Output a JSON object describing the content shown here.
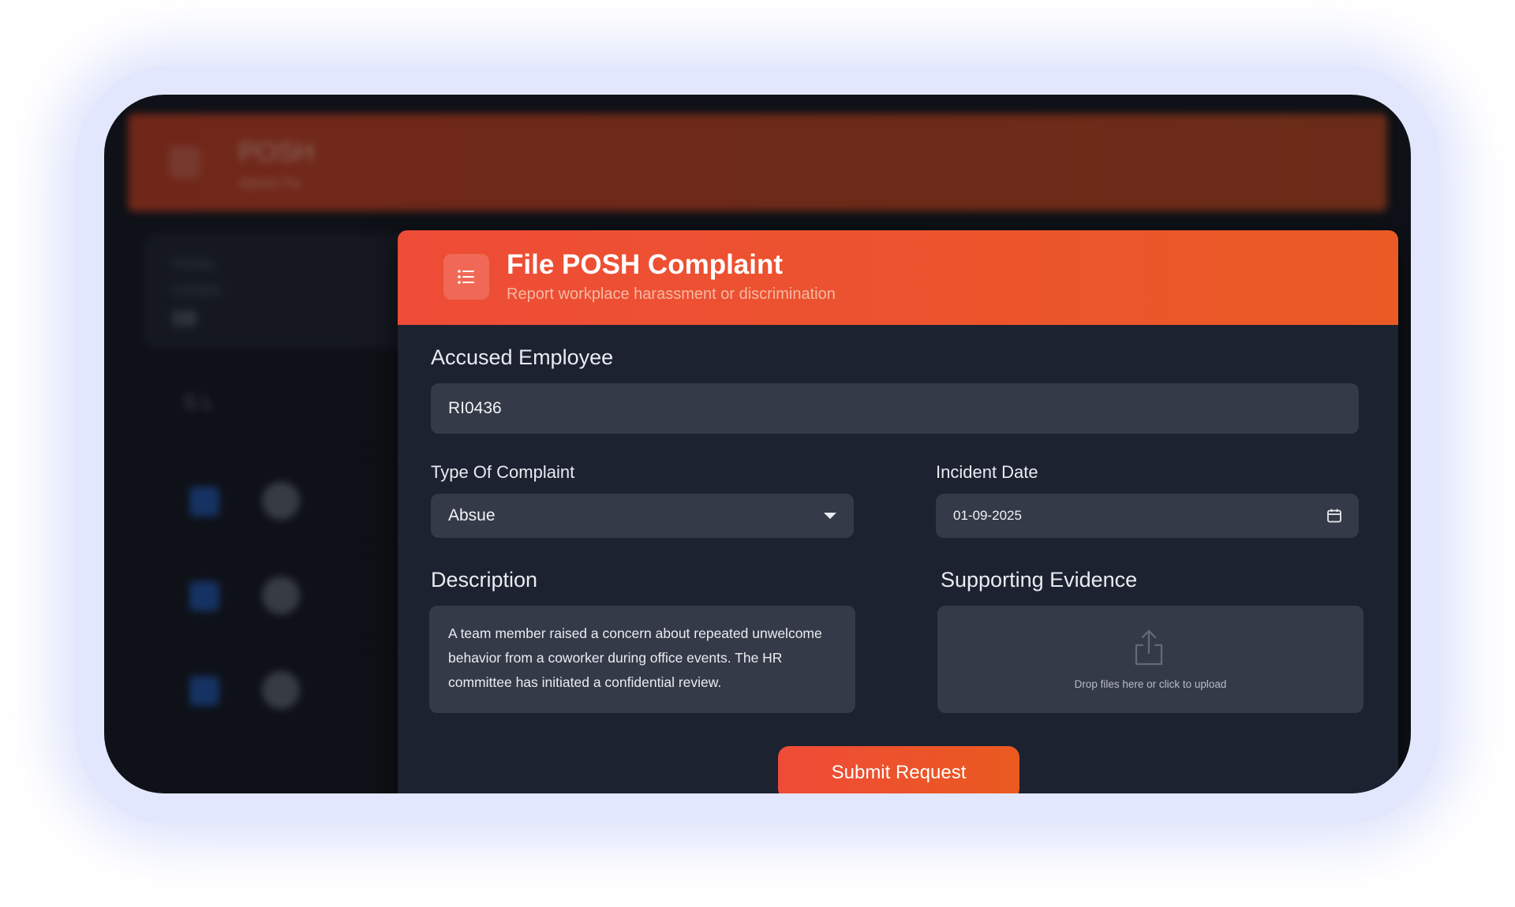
{
  "background": {
    "header_title": "POSH",
    "header_subtitle": "Admin Pa",
    "stats_label": "TOTAL CASES",
    "stats_value": "08",
    "table_header": "S.L"
  },
  "modal": {
    "title": "File POSH Complaint",
    "subtitle": "Report workplace harassment or discrimination",
    "accused": {
      "label": "Accused Employee",
      "value": "RI0436"
    },
    "complaint_type": {
      "label": "Type Of Complaint",
      "value": "Absue"
    },
    "incident_date": {
      "label": "Incident Date",
      "value": "01-09-2025"
    },
    "description": {
      "label": "Description",
      "value": "A team member raised a concern about repeated unwelcome behavior from a coworker during office events. The HR committee has initiated a confidential review."
    },
    "evidence": {
      "label": "Supporting Evidence",
      "hint": "Drop files here or click to upload"
    },
    "submit_label": "Submit Request"
  },
  "icons": {
    "menu": "menu-icon",
    "dropdown": "chevron-down-icon",
    "calendar": "calendar-icon",
    "upload": "upload-icon"
  },
  "colors": {
    "accent": "#ee4c37",
    "modal_bg": "#1c2230",
    "field_bg": "#343a47"
  }
}
